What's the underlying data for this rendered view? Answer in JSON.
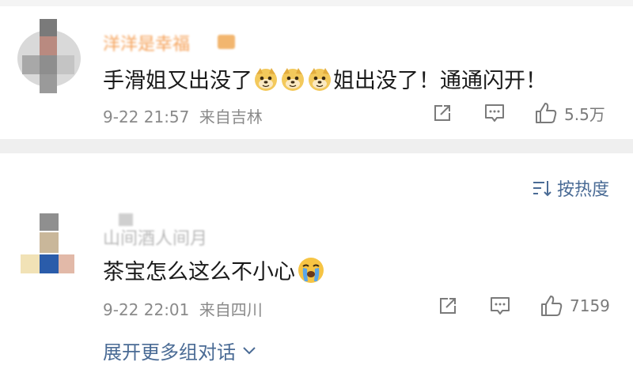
{
  "comments": [
    {
      "username": "洋洋是幸福",
      "text_before_emoji": "手滑姐又出没了",
      "emojis": [
        "doge",
        "doge",
        "doge"
      ],
      "text_after_emoji": "姐出没了！通通闪开！",
      "timestamp": "9-22 21:57",
      "source": "来自吉林",
      "like_count": "5.5万"
    },
    {
      "username": "山间酒人间月",
      "text": "茶宝怎么这么不小心",
      "emoji": "crying-face",
      "timestamp": "9-22 22:01",
      "source": "来自四川",
      "like_count": "7159"
    }
  ],
  "sort": {
    "label": "按热度"
  },
  "expand": {
    "label": "展开更多组对话"
  },
  "colors": {
    "link": "#4a6b95",
    "meta": "#8a8a8a",
    "username_orange": "#f5a25a"
  }
}
